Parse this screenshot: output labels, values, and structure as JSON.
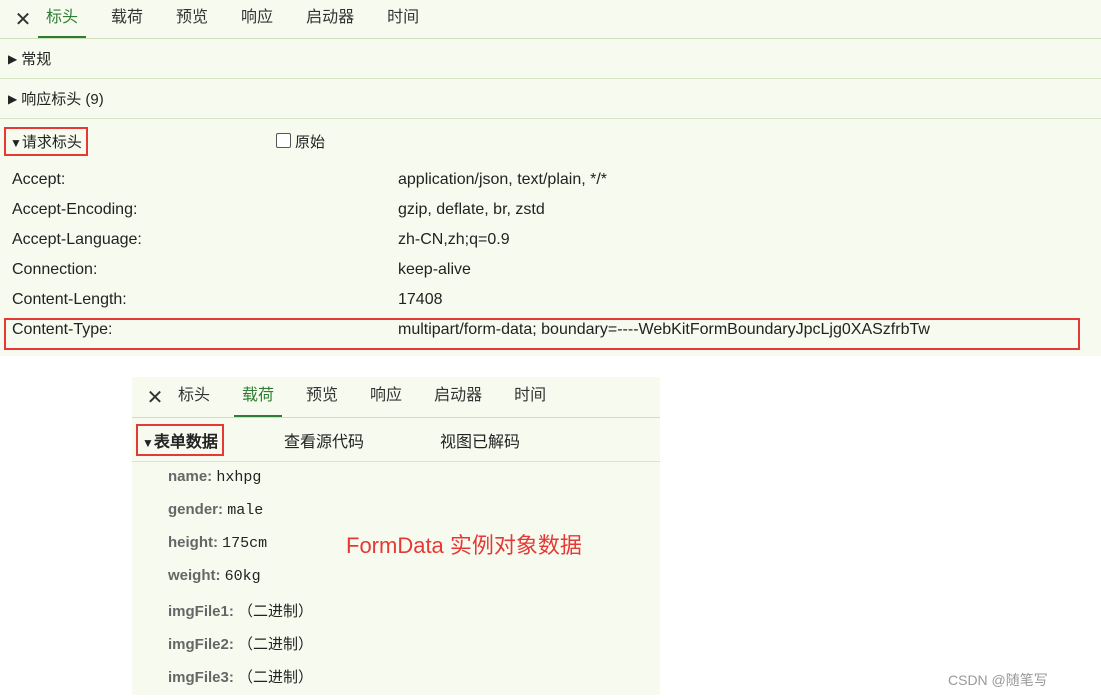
{
  "panel1": {
    "tabs": [
      "标头",
      "载荷",
      "预览",
      "响应",
      "启动器",
      "时间"
    ],
    "active_tab": "标头",
    "sections": {
      "general": "常规",
      "response_headers": "响应标头 (9)",
      "request_headers": "请求标头",
      "raw_checkbox": "原始"
    },
    "headers": [
      {
        "k": "Accept:",
        "v": "application/json, text/plain, */*"
      },
      {
        "k": "Accept-Encoding:",
        "v": "gzip, deflate, br, zstd"
      },
      {
        "k": "Accept-Language:",
        "v": "zh-CN,zh;q=0.9"
      },
      {
        "k": "Connection:",
        "v": "keep-alive"
      },
      {
        "k": "Content-Length:",
        "v": "17408"
      },
      {
        "k": "Content-Type:",
        "v": "multipart/form-data; boundary=----WebKitFormBoundaryJpcLjg0XASzfrbTw"
      }
    ]
  },
  "panel2": {
    "tabs": [
      "标头",
      "载荷",
      "预览",
      "响应",
      "启动器",
      "时间"
    ],
    "active_tab": "载荷",
    "form_data_label": "表单数据",
    "view_source": "查看源代码",
    "view_decoded": "视图已解码",
    "fields": [
      {
        "k": "name:",
        "v": "hxhpg"
      },
      {
        "k": "gender:",
        "v": "male"
      },
      {
        "k": "height:",
        "v": "175cm"
      },
      {
        "k": "weight:",
        "v": "60kg"
      },
      {
        "k": "imgFile1:",
        "v": "（二进制）"
      },
      {
        "k": "imgFile2:",
        "v": "（二进制）"
      },
      {
        "k": "imgFile3:",
        "v": "（二进制）"
      }
    ]
  },
  "annotation": "FormData 实例对象数据",
  "watermark": "CSDN @随笔写",
  "colors": {
    "accent": "#2e7d32",
    "highlight": "#e53935",
    "panel_bg": "#f7fbef"
  }
}
